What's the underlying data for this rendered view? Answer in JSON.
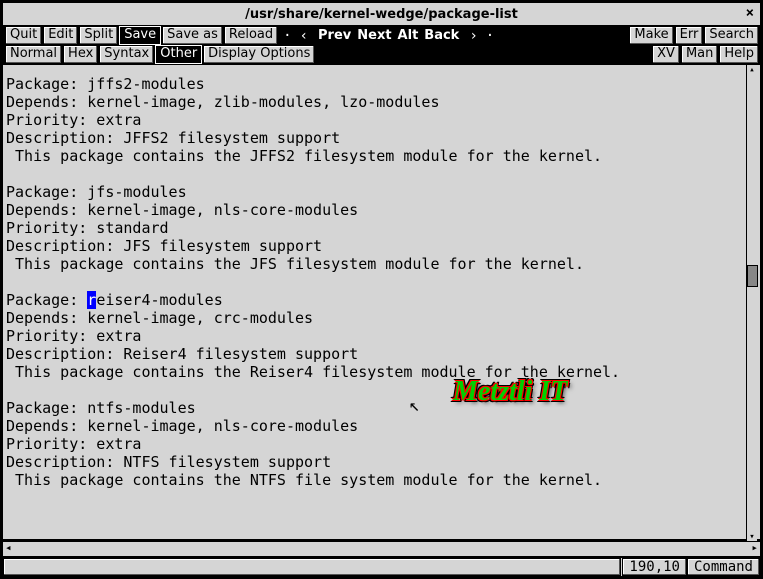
{
  "title": "/usr/share/kernel-wedge/package-list",
  "toolbar1": {
    "quit": "Quit",
    "edit": "Edit",
    "split": "Split",
    "save": "Save",
    "save_as": "Save as",
    "reload": "Reload",
    "nav_prev": "Prev",
    "nav_next": "Next",
    "nav_alt": "Alt",
    "nav_back": "Back",
    "make": "Make",
    "err": "Err",
    "search": "Search"
  },
  "toolbar2": {
    "normal": "Normal",
    "hex": "Hex",
    "syntax": "Syntax",
    "other": "Other",
    "display_options": "Display Options",
    "xv": "XV",
    "man": "Man",
    "help": "Help"
  },
  "content": {
    "pre_cursor": "Package: jffs2-modules\nDepends: kernel-image, zlib-modules, lzo-modules\nPriority: extra\nDescription: JFFS2 filesystem support\n This package contains the JFFS2 filesystem module for the kernel.\n\nPackage: jfs-modules\nDepends: kernel-image, nls-core-modules\nPriority: standard\nDescription: JFS filesystem support\n This package contains the JFS filesystem module for the kernel.\n\nPackage: ",
    "cursor_char": "r",
    "post_cursor": "eiser4-modules\nDepends: kernel-image, crc-modules\nPriority: extra\nDescription: Reiser4 filesystem support\n This package contains the Reiser4 filesystem module for the kernel.\n\nPackage: ntfs-modules\nDepends: kernel-image, nls-core-modules\nPriority: extra\nDescription: NTFS filesystem support\n This package contains the NTFS file system module for the kernel.\n"
  },
  "watermark": "Metztli IT",
  "status": {
    "pos": "190,10",
    "mode": "Command"
  }
}
